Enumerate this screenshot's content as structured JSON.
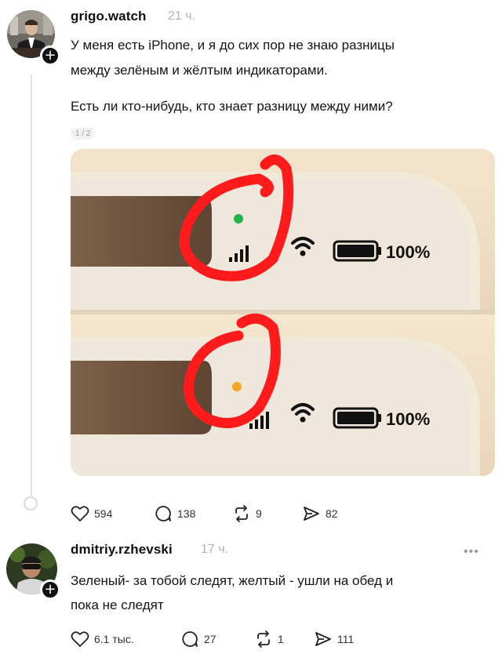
{
  "post": {
    "username": "grigo.watch",
    "time": "21 ч.",
    "text_line1": "У меня есть iPhone, и я до сих пор не знаю разницы",
    "text_line2": "между зелёным и жёлтым индикаторами.",
    "text_line3": "Есть ли кто-нибудь, кто знает разницу между ними?",
    "image_counter": "1 / 2",
    "image": {
      "top_panel": {
        "battery_text": "100%",
        "indicator_color": "#22b24c"
      },
      "bottom_panel": {
        "battery_text": "100%",
        "indicator_color": "#f5a623"
      },
      "annotation_color": "#ff1b1b"
    },
    "actions": {
      "likes": "594",
      "comments": "138",
      "reposts": "9",
      "shares": "82"
    }
  },
  "reply": {
    "username": "dmitriy.rzhevski",
    "time": "17 ч.",
    "text_line1": "Зеленый- за тобой следят, желтый - ушли на обед и",
    "text_line2": "пока не следят",
    "more_icon": "more-dots-icon",
    "actions": {
      "likes": "6.1 тыс.",
      "comments": "27",
      "reposts": "1",
      "shares": "111"
    }
  }
}
